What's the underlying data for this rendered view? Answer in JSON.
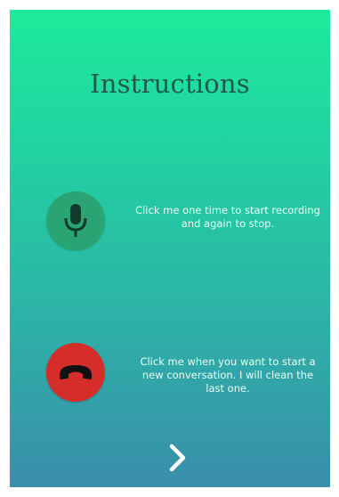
{
  "header": {
    "title": "Instructions"
  },
  "instructions": [
    {
      "icon": "microphone-icon",
      "text": "Click me one time to start recording and again to stop."
    },
    {
      "icon": "hang-up-phone-icon",
      "text": "Click me when you want to start a new conversation. I will clean the last one."
    }
  ],
  "navigation": {
    "next_icon": "chevron-right-icon"
  },
  "colors": {
    "gradient_top": "#1eea9b",
    "gradient_bottom": "#3a8eab",
    "title_color": "#215a4d",
    "mic_button": "#2aa472",
    "hangup_button": "#d52e2a",
    "text_color": "#eafff6"
  }
}
